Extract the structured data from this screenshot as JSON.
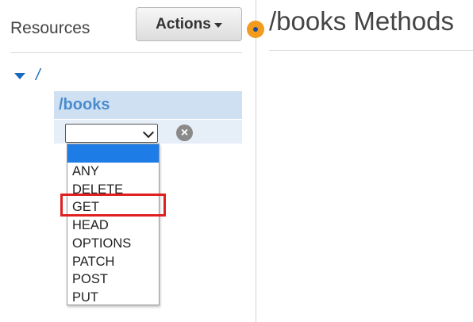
{
  "sidebar": {
    "title": "Resources",
    "actions_label": "Actions",
    "tree": {
      "root_label": "/",
      "child_label": "/books"
    }
  },
  "method_dropdown": {
    "selected_value": "",
    "options": [
      "",
      "ANY",
      "DELETE",
      "GET",
      "HEAD",
      "OPTIONS",
      "PATCH",
      "POST",
      "PUT"
    ],
    "highlighted_option": "GET"
  },
  "main": {
    "title": "/books Methods"
  },
  "colors": {
    "link_blue": "#1a6bbd",
    "selected_node_bg": "#cfe0f3",
    "dropdown_selected_bg": "#1e7ce6",
    "highlight_red": "#e02020",
    "indicator_orange": "#f29b1d"
  }
}
